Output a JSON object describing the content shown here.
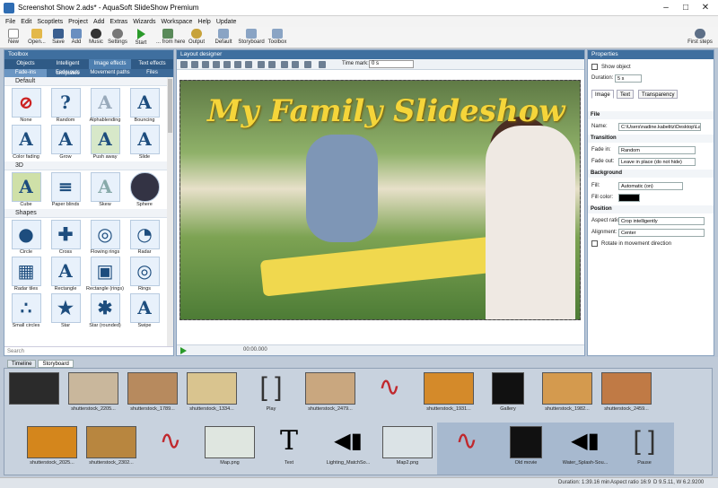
{
  "window": {
    "title": "Screenshot Show 2.ads* - AquaSoft SlideShow Premium"
  },
  "menu": [
    "File",
    "Edit",
    "Scoptlets",
    "Project",
    "Add",
    "Extras",
    "Wizards",
    "Workspace",
    "Help",
    "Update"
  ],
  "toolbar": [
    "New",
    "Open...",
    "Save",
    "Add",
    "Music",
    "Settings",
    "Start",
    "... from here",
    "Output",
    "Default",
    "Storyboard",
    "Toolbox",
    "First steps"
  ],
  "toolbox": {
    "title": "Toolbox",
    "tabs": [
      "Objects",
      "Intelligent templates",
      "Image effects",
      "Text effects"
    ],
    "subtabs": [
      "Fade-ins",
      "Fade-outs",
      "Movement paths",
      "Files"
    ],
    "sections": [
      {
        "name": "Default",
        "items": [
          "None",
          "Random",
          "Alphablending",
          "Bouncing",
          "Color fading",
          "Grow",
          "Push away",
          "Slide"
        ]
      },
      {
        "name": "3D",
        "items": [
          "Cube",
          "Paper blinds",
          "Skew",
          "Sphere"
        ]
      },
      {
        "name": "Shapes",
        "items": [
          "Circle",
          "Cross",
          "Flowing rings",
          "Radar",
          "Radar tiles",
          "Rectangle",
          "Rectangle (rings)",
          "Rings",
          "Small circles",
          "Star",
          "Star (rounded)",
          "Swipe"
        ]
      }
    ],
    "search": "Search"
  },
  "designer": {
    "title": "Layout designer",
    "time_mark_label": "Time mark:",
    "time_mark_value": "0 s",
    "slide_title": "My Family Slideshow",
    "play_time": "00:00.000"
  },
  "properties": {
    "title": "Properties",
    "show_object": "Show object",
    "duration_label": "Duration:",
    "duration_value": "5 s",
    "tabs": [
      "Image",
      "Text",
      "Transparency"
    ],
    "file_section": "File",
    "name_label": "Name:",
    "name_value": "C:\\Users\\nadine.kabelitz\\Desktop\\Lan",
    "transition_section": "Transition",
    "fade_in_label": "Fade in:",
    "fade_in_value": "Random",
    "fade_out_label": "Fade out:",
    "fade_out_value": "Leave in place (do not hide)",
    "background_section": "Background",
    "fill_label": "Fill:",
    "fill_value": "Automatic (on)",
    "fill_color_label": "Fill color:",
    "position_section": "Position",
    "aspect_label": "Aspect ratio:",
    "aspect_value": "Crop intelligently",
    "alignment_label": "Alignment:",
    "alignment_value": "Center",
    "rotate_label": "Rotate in movement direction"
  },
  "storyboard": {
    "tabs": [
      "Timeline",
      "Storyboard"
    ],
    "row1": [
      "",
      "shutterstock_2205...",
      "shutterstock_1789...",
      "shutterstock_1334...",
      "Play",
      "shutterstock_2479...",
      "",
      "shutterstock_1931...",
      "Gallery",
      "shutterstock_1982...",
      "shutterstock_2459..."
    ],
    "row2": [
      "shutterstock_2025...",
      "shutterstock_2302...",
      "",
      "Map.png",
      "Text",
      "Lighting_MatchSo...",
      "Map2.png",
      "",
      "Old movie",
      "Water_Splash-Sou...",
      "Pause"
    ]
  },
  "status": {
    "duration": "Duration: 1:39.16 min",
    "aspect": "Aspect ratio 16:9",
    "version": "D 9.5.11, W 6.2.9200"
  }
}
